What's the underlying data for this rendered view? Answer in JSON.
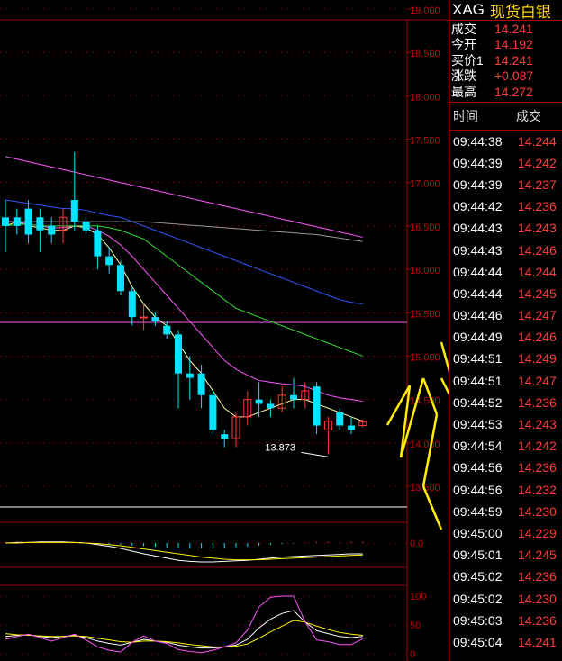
{
  "quote": {
    "symbol": "XAG",
    "name": "现货白银",
    "rows": [
      {
        "label": "成交",
        "value": "14.241"
      },
      {
        "label": "今开",
        "value": "14.192"
      },
      {
        "label": "买价1",
        "value": "14.241"
      },
      {
        "label": "涨跌",
        "value": "+0.087"
      },
      {
        "label": "最高",
        "value": "14.272"
      }
    ]
  },
  "trades": {
    "header_time": "时间",
    "header_price": "成交",
    "rows": [
      {
        "time": "09:44:38",
        "price": "14.244"
      },
      {
        "time": "09:44:39",
        "price": "14.242"
      },
      {
        "time": "09:44:39",
        "price": "14.237"
      },
      {
        "time": "09:44:42",
        "price": "14.236"
      },
      {
        "time": "09:44:43",
        "price": "14.243"
      },
      {
        "time": "09:44:43",
        "price": "14.246"
      },
      {
        "time": "09:44:44",
        "price": "14.244"
      },
      {
        "time": "09:44:44",
        "price": "14.245"
      },
      {
        "time": "09:44:46",
        "price": "14.247"
      },
      {
        "time": "09:44:49",
        "price": "14.246"
      },
      {
        "time": "09:44:51",
        "price": "14.249"
      },
      {
        "time": "09:44:51",
        "price": "14.247"
      },
      {
        "time": "09:44:52",
        "price": "14.236"
      },
      {
        "time": "09:44:53",
        "price": "14.243"
      },
      {
        "time": "09:44:54",
        "price": "14.242"
      },
      {
        "time": "09:44:56",
        "price": "14.236"
      },
      {
        "time": "09:44:56",
        "price": "14.232"
      },
      {
        "time": "09:44:59",
        "price": "14.230"
      },
      {
        "time": "09:45:00",
        "price": "14.229"
      },
      {
        "time": "09:45:01",
        "price": "14.245"
      },
      {
        "time": "09:45:02",
        "price": "14.236"
      },
      {
        "time": "09:45:02",
        "price": "14.230"
      },
      {
        "time": "09:45:03",
        "price": "14.236"
      },
      {
        "time": "09:45:04",
        "price": "14.241"
      }
    ]
  },
  "colors": {
    "up": "#ff3b3b",
    "down": "#00e5ff",
    "grid": "#a00000",
    "arrow": "#ffee00",
    "ma1": "#ffffaa",
    "ma2": "#ff55ff",
    "ma3": "#33dd33",
    "ma4": "#3355ff",
    "ma5": "#ff55ff",
    "ma6": "#999999"
  },
  "chart_data": {
    "type": "candlestick",
    "ylim": [
      13.5,
      19.0
    ],
    "yticks": [
      "19.000",
      "18.500",
      "18.000",
      "17.500",
      "17.000",
      "16.500",
      "16.000",
      "15.500",
      "15.000",
      "14.500",
      "14.000",
      "13.500"
    ],
    "low_annotation": "13.873",
    "candles": [
      {
        "o": 16.6,
        "h": 16.8,
        "l": 16.2,
        "c": 16.5
      },
      {
        "o": 16.6,
        "h": 16.7,
        "l": 16.4,
        "c": 16.5
      },
      {
        "o": 16.7,
        "h": 16.8,
        "l": 16.3,
        "c": 16.4
      },
      {
        "o": 16.6,
        "h": 16.7,
        "l": 16.2,
        "c": 16.45
      },
      {
        "o": 16.5,
        "h": 16.6,
        "l": 16.3,
        "c": 16.4
      },
      {
        "o": 16.45,
        "h": 16.7,
        "l": 16.3,
        "c": 16.6
      },
      {
        "o": 16.8,
        "h": 17.35,
        "l": 16.45,
        "c": 16.55
      },
      {
        "o": 16.55,
        "h": 16.6,
        "l": 16.4,
        "c": 16.45
      },
      {
        "o": 16.45,
        "h": 16.5,
        "l": 16.0,
        "c": 16.15
      },
      {
        "o": 16.15,
        "h": 16.25,
        "l": 15.95,
        "c": 16.05
      },
      {
        "o": 16.05,
        "h": 16.1,
        "l": 15.7,
        "c": 15.75
      },
      {
        "o": 15.75,
        "h": 15.8,
        "l": 15.35,
        "c": 15.45
      },
      {
        "o": 15.45,
        "h": 15.6,
        "l": 15.3,
        "c": 15.45
      },
      {
        "o": 15.45,
        "h": 15.5,
        "l": 15.35,
        "c": 15.4
      },
      {
        "o": 15.35,
        "h": 15.4,
        "l": 15.2,
        "c": 15.25
      },
      {
        "o": 15.25,
        "h": 15.3,
        "l": 14.4,
        "c": 14.8
      },
      {
        "o": 14.8,
        "h": 15.0,
        "l": 14.5,
        "c": 14.75
      },
      {
        "o": 14.8,
        "h": 14.9,
        "l": 14.4,
        "c": 14.55
      },
      {
        "o": 14.55,
        "h": 14.6,
        "l": 14.1,
        "c": 14.15
      },
      {
        "o": 14.1,
        "h": 14.15,
        "l": 13.95,
        "c": 14.05
      },
      {
        "o": 14.05,
        "h": 14.35,
        "l": 13.95,
        "c": 14.3
      },
      {
        "o": 14.3,
        "h": 14.6,
        "l": 14.2,
        "c": 14.5
      },
      {
        "o": 14.5,
        "h": 14.7,
        "l": 14.3,
        "c": 14.45
      },
      {
        "o": 14.45,
        "h": 14.5,
        "l": 14.3,
        "c": 14.4
      },
      {
        "o": 14.4,
        "h": 14.65,
        "l": 14.35,
        "c": 14.55
      },
      {
        "o": 14.55,
        "h": 14.75,
        "l": 14.4,
        "c": 14.5
      },
      {
        "o": 14.5,
        "h": 14.7,
        "l": 14.4,
        "c": 14.6
      },
      {
        "o": 14.65,
        "h": 14.7,
        "l": 14.1,
        "c": 14.2
      },
      {
        "o": 14.15,
        "h": 14.3,
        "l": 13.87,
        "c": 14.25
      },
      {
        "o": 14.35,
        "h": 14.4,
        "l": 14.15,
        "c": 14.2
      },
      {
        "o": 14.2,
        "h": 14.3,
        "l": 14.1,
        "c": 14.15
      },
      {
        "o": 14.2,
        "h": 14.27,
        "l": 14.18,
        "c": 14.24
      }
    ],
    "ma_lines": [
      {
        "color": "ma1",
        "values": [
          16.5,
          16.55,
          16.5,
          16.48,
          16.45,
          16.45,
          16.5,
          16.48,
          16.4,
          16.25,
          16.05,
          15.8,
          15.6,
          15.45,
          15.35,
          15.15,
          14.95,
          14.8,
          14.6,
          14.4,
          14.3,
          14.3,
          14.35,
          14.4,
          14.45,
          14.5,
          14.5,
          14.45,
          14.4,
          14.35,
          14.3,
          14.25
        ]
      },
      {
        "color": "ma2",
        "values": [
          16.55,
          16.55,
          16.52,
          16.5,
          16.48,
          16.48,
          16.5,
          16.5,
          16.45,
          16.38,
          16.28,
          16.15,
          16.0,
          15.85,
          15.7,
          15.55,
          15.4,
          15.25,
          15.1,
          14.95,
          14.85,
          14.78,
          14.72,
          14.7,
          14.68,
          14.67,
          14.65,
          14.6,
          14.55,
          14.52,
          14.5,
          14.48
        ]
      },
      {
        "color": "ma3",
        "values": [
          16.5,
          16.52,
          16.52,
          16.5,
          16.5,
          16.5,
          16.5,
          16.5,
          16.5,
          16.48,
          16.45,
          16.4,
          16.35,
          16.25,
          16.15,
          16.05,
          15.95,
          15.85,
          15.75,
          15.65,
          15.55,
          15.5,
          15.45,
          15.4,
          15.35,
          15.3,
          15.25,
          15.2,
          15.15,
          15.1,
          15.05,
          15.0
        ]
      },
      {
        "color": "ma4",
        "values": [
          16.8,
          16.78,
          16.76,
          16.74,
          16.72,
          16.7,
          16.7,
          16.68,
          16.65,
          16.62,
          16.6,
          16.55,
          16.5,
          16.45,
          16.4,
          16.35,
          16.3,
          16.25,
          16.2,
          16.15,
          16.1,
          16.05,
          16.0,
          15.95,
          15.9,
          15.85,
          15.8,
          15.75,
          15.7,
          15.65,
          15.62,
          15.6
        ]
      },
      {
        "color": "ma5",
        "values": [
          17.3,
          17.27,
          17.24,
          17.21,
          17.18,
          17.15,
          17.12,
          17.09,
          17.06,
          17.03,
          17.0,
          16.97,
          16.94,
          16.91,
          16.88,
          16.85,
          16.82,
          16.79,
          16.76,
          16.73,
          16.7,
          16.67,
          16.64,
          16.61,
          16.58,
          16.55,
          16.52,
          16.49,
          16.46,
          16.43,
          16.4,
          16.37
        ]
      },
      {
        "color": "ma6",
        "values": [
          16.55,
          16.55,
          16.55,
          16.55,
          16.55,
          16.55,
          16.55,
          16.55,
          16.55,
          16.55,
          16.55,
          16.55,
          16.55,
          16.54,
          16.53,
          16.52,
          16.51,
          16.5,
          16.49,
          16.48,
          16.47,
          16.46,
          16.45,
          16.44,
          16.43,
          16.42,
          16.41,
          16.4,
          16.38,
          16.36,
          16.34,
          16.32
        ]
      }
    ],
    "macd": {
      "yticks": [
        "0.0"
      ],
      "hist": [
        0.02,
        0.03,
        0.02,
        0.02,
        0.02,
        0.01,
        0.01,
        0.0,
        -0.01,
        -0.02,
        -0.03,
        -0.05,
        -0.06,
        -0.07,
        -0.08,
        -0.09,
        -0.1,
        -0.1,
        -0.1,
        -0.09,
        -0.08,
        -0.07,
        -0.05,
        -0.03,
        -0.02,
        -0.01,
        0.01,
        0.02,
        0.02,
        0.01,
        0.02,
        0.02
      ],
      "dif": [
        0.0,
        0.01,
        0.01,
        0.02,
        0.02,
        0.02,
        0.01,
        0.0,
        -0.03,
        -0.06,
        -0.1,
        -0.15,
        -0.2,
        -0.24,
        -0.28,
        -0.32,
        -0.34,
        -0.35,
        -0.35,
        -0.34,
        -0.33,
        -0.32,
        -0.3,
        -0.28,
        -0.26,
        -0.25,
        -0.24,
        -0.23,
        -0.22,
        -0.21,
        -0.2,
        -0.2
      ],
      "dea": [
        0.0,
        0.0,
        0.01,
        0.01,
        0.01,
        0.01,
        0.01,
        0.0,
        -0.01,
        -0.03,
        -0.05,
        -0.08,
        -0.11,
        -0.14,
        -0.17,
        -0.2,
        -0.23,
        -0.26,
        -0.28,
        -0.3,
        -0.31,
        -0.31,
        -0.31,
        -0.3,
        -0.29,
        -0.28,
        -0.27,
        -0.26,
        -0.25,
        -0.24,
        -0.23,
        -0.22
      ]
    },
    "kdj": {
      "yticks": [
        "100",
        "50",
        "0"
      ],
      "k": [
        30,
        32,
        33,
        30,
        28,
        30,
        32,
        28,
        22,
        18,
        15,
        20,
        25,
        22,
        20,
        15,
        12,
        10,
        10,
        12,
        15,
        25,
        45,
        60,
        70,
        75,
        55,
        40,
        35,
        30,
        28,
        30
      ],
      "d": [
        35,
        33,
        32,
        31,
        30,
        30,
        31,
        30,
        27,
        24,
        21,
        20,
        22,
        22,
        21,
        19,
        16,
        14,
        12,
        12,
        13,
        17,
        27,
        38,
        48,
        58,
        55,
        48,
        42,
        37,
        34,
        32
      ],
      "j": [
        25,
        30,
        34,
        28,
        22,
        28,
        34,
        24,
        12,
        6,
        3,
        20,
        31,
        22,
        18,
        7,
        4,
        2,
        6,
        12,
        19,
        41,
        81,
        98,
        100,
        100,
        55,
        24,
        21,
        16,
        16,
        26
      ]
    }
  }
}
